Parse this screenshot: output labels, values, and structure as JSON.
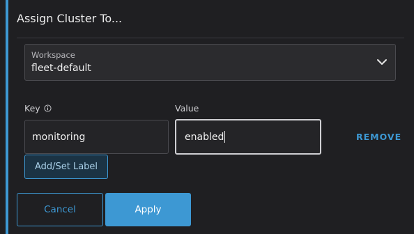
{
  "dialog": {
    "title": "Assign Cluster To..."
  },
  "workspace": {
    "label": "Workspace",
    "value": "fleet-default",
    "icon": "chevron-down-icon"
  },
  "labels": {
    "key_label": "Key",
    "key_info_icon": "info-icon",
    "value_label": "Value",
    "rows": [
      {
        "key": "monitoring",
        "value": "enabled",
        "remove_label": "REMOVE"
      }
    ],
    "add_button": "Add/Set Label"
  },
  "actions": {
    "cancel_label": "Cancel",
    "apply_label": "Apply"
  },
  "colors": {
    "accent": "#3d98d3",
    "background": "#1f1f22"
  }
}
